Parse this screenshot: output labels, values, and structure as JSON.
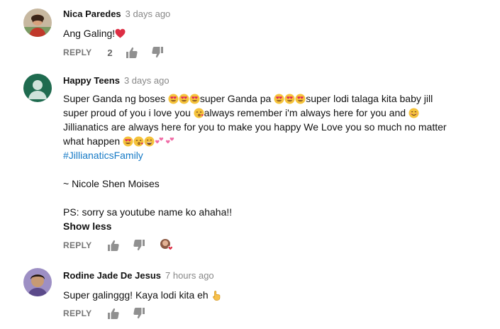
{
  "comments": [
    {
      "author": "Nica Paredes",
      "time": "3 days ago",
      "text": "Ang Galing!",
      "reply_label": "REPLY",
      "like_count": "2"
    },
    {
      "author": "Happy Teens",
      "time": "3 days ago",
      "line1_a": "Super Ganda ng boses ",
      "line1_b": "super Ganda pa ",
      "line1_c": "super lodi talaga kita baby jill",
      "line2_a": "super proud of you i love you ",
      "line2_b": "always remember i'm always here for you and ",
      "line3": "Jillianatics are always here for you to make you happy We Love you so much no matter",
      "line4": "what happen ",
      "hashtag": "#JillianaticsFamily",
      "signature": "~ Nicole Shen Moises",
      "ps": "PS: sorry sa youtube name ko ahaha!!",
      "show_less": "Show less",
      "reply_label": "REPLY"
    },
    {
      "author": "Rodine Jade De Jesus",
      "time": "7 hours ago",
      "text": "Super galinggg! Kaya lodi kita eh ",
      "reply_label": "REPLY"
    }
  ],
  "icons": {
    "like": "thumbs-up-icon",
    "dislike": "thumbs-down-icon",
    "heart_emoji": "red-heart",
    "heart_eyes": "smiling-face-with-heart-eyes",
    "kiss": "face-blowing-a-kiss",
    "smile": "smiling-face",
    "pointing": "pointing-up-hand"
  },
  "colors": {
    "hashtag": "#167ac6",
    "secondary_text": "#888888",
    "reply": "#767676"
  }
}
